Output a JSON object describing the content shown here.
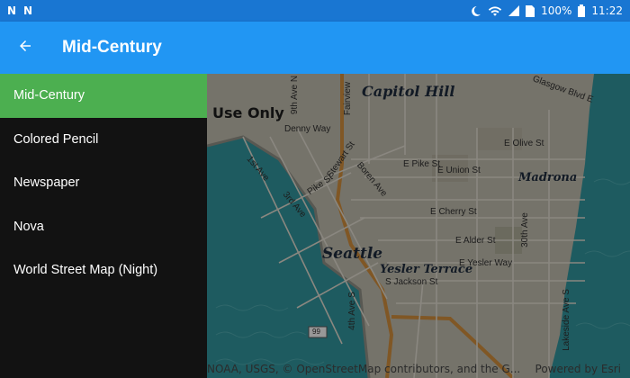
{
  "status_bar": {
    "left_icons": [
      "N",
      "N"
    ],
    "battery": "100%",
    "time": "11:22"
  },
  "app_bar": {
    "title": "Mid-Century"
  },
  "drawer": {
    "items": [
      {
        "label": "Mid-Century",
        "active": true
      },
      {
        "label": "Colored Pencil",
        "active": false
      },
      {
        "label": "Newspaper",
        "active": false
      },
      {
        "label": "Nova",
        "active": false
      },
      {
        "label": "World Street Map (Night)",
        "active": false
      }
    ]
  },
  "map": {
    "watermark": "Use Only",
    "neighborhoods": {
      "capitol_hill": "Capitol Hill",
      "madrona": "Madrona",
      "seattle": "Seattle",
      "yesler_terrace": "Yesler Terrace"
    },
    "streets": {
      "e_olive": "E Olive St",
      "e_pike": "E Pike St",
      "e_union": "E Union St",
      "e_cherry": "E Cherry St",
      "e_alder": "E Alder St",
      "e_yesler": "E Yesler Way",
      "s_jackson": "S Jackson St",
      "denny": "Denny Way",
      "pike": "Pike St",
      "stewart": "Stewart St",
      "boren": "Boren Ave",
      "first": "1st Ave",
      "third": "3rd Ave",
      "fourth": "4th Ave S",
      "thirtieth": "30th Ave",
      "fairview": "Fairview",
      "ninth": "9th Ave N",
      "lakeside": "Lakeside Ave S",
      "glasgow": "Glasgow Blvd E",
      "route": "99"
    },
    "attribution": "NOAA, USGS, © OpenStreetMap contributors, and the G...",
    "powered_by": "Powered by Esri"
  },
  "colors": {
    "status_bar": "#1976d2",
    "app_bar": "#2196f3",
    "drawer_bg": "#121212",
    "drawer_active": "#4caf50"
  }
}
